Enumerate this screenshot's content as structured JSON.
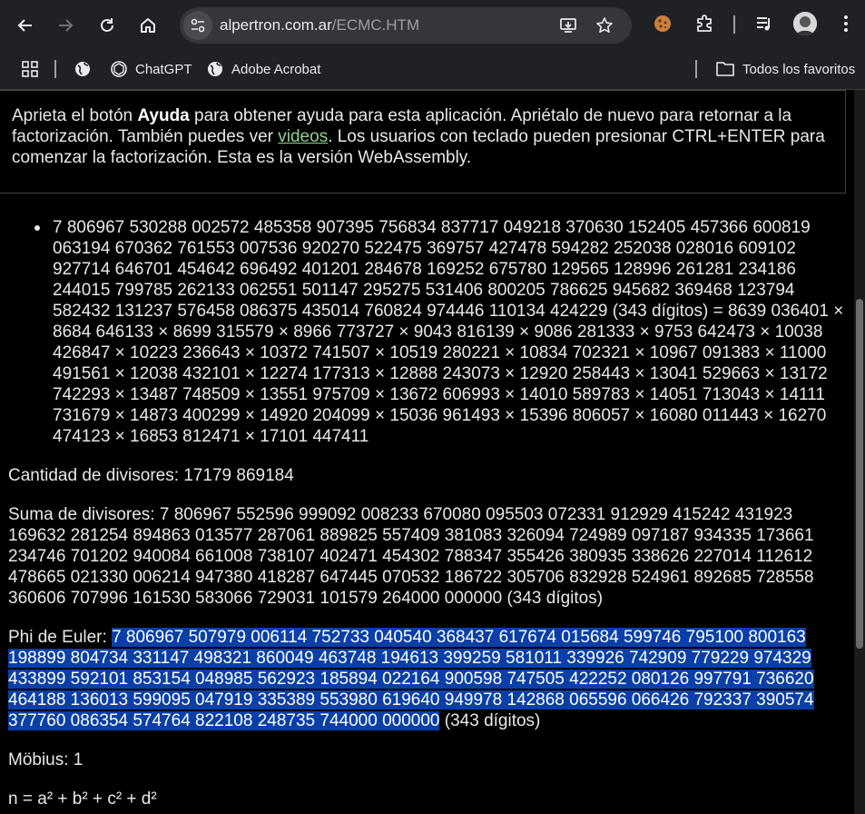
{
  "browser": {
    "url_host": "alpertron.com.ar",
    "url_path": "/ECMC.HTM",
    "bookmarks": [
      {
        "label": "ChatGPT",
        "icon": "chatgpt-icon"
      },
      {
        "label": "Adobe Acrobat",
        "icon": "globe-icon"
      }
    ],
    "all_bookmarks_label": "Todos los favoritos"
  },
  "help": {
    "t1": "Aprieta el botón ",
    "bold": "Ayuda",
    "t2": " para obtener ayuda para esta aplicación. Apriétalo de nuevo para retornar a la factorización. También puedes ver ",
    "link": "videos",
    "t3": ". Los usuarios con teclado pueden presionar CTRL+ENTER para comenzar la factorización. Esta es la versión WebAssembly."
  },
  "result": {
    "factorization": "7 806967 530288 002572 485358 907395 756834 837717 049218 370630 152405 457366 600819 063194 670362 761553 007536 920270 522475 369757 427478 594282 252038 028016 609102 927714 646701 454642 696492 401201 284678 169252 675780 129565 128996 261281 234186 244015 799785 262133 062551 501147 295275 531406 800205 786625 945682 369468 123794 582432 131237 576458 086375 435014 760824 974446 110134 424229 (343 dígitos) = 8639 036401 × 8684 646133 × 8699 315579 × 8966 773727 × 9043 816139 × 9086 281333 × 9753 642473 × 10038 426847 × 10223 236643 × 10372 741507 × 10519 280221 × 10834 702321 × 10967 091383 × 11000 491561 × 12038 432101 × 12274 177313 × 12888 243073 × 12920 258443 × 13041 529663 × 13172 742293 × 13487 748509 × 13551 975709 × 13672 606993 × 14010 589783 × 14051 713043 × 14111 731679 × 14873 400299 × 14920 204099 × 15036 961493 × 15396 806057 × 16080 011443 × 16270 474123 × 16853 812471 × 17101 447411",
    "divisors_count": "Cantidad de divisores: 17179 869184",
    "divisors_sum": "Suma de divisores: 7 806967 552596 999092 008233 670080 095503 072331 912929 415242 431923 169632 281254 894863 013577 287061 889825 557409 381083 326094 724989 097187 934335 173661 234746 701202 940084 661008 738107 402471 454302 788347 355426 380935 338626 227014 112612 478665 021330 006214 947380 418287 647445 070532 186722 305706 832928 524961 892685 728558 360606 707996 161530 583066 729031 101579 264000 000000 (343 dígitos)",
    "phi_label": "Phi de Euler: ",
    "phi_value": "7 806967 507979 006114 752733 040540 368437 617674 015684 599746 795100 800163 198899 804734 331147 498321 860049 463748 194613 399259 581011 339926 742909 779229 974329 433899 592101 853154 048985 562923 185894 022164 900598 747505 422252 080126 997791 736620 464188 136013 599095 047919 335389 553980 619640 949978 142868 065596 066426 792337 390574 377760 086354 574764 822108 248735 744000 000000",
    "phi_digits": " (343 dígitos)",
    "mobius": "Möbius: 1",
    "sum_squares": "n = a² + b² + c² + d²"
  },
  "colors": {
    "selection": "#0a3fa8",
    "link": "#8fd18f",
    "chrome": "#202124"
  }
}
